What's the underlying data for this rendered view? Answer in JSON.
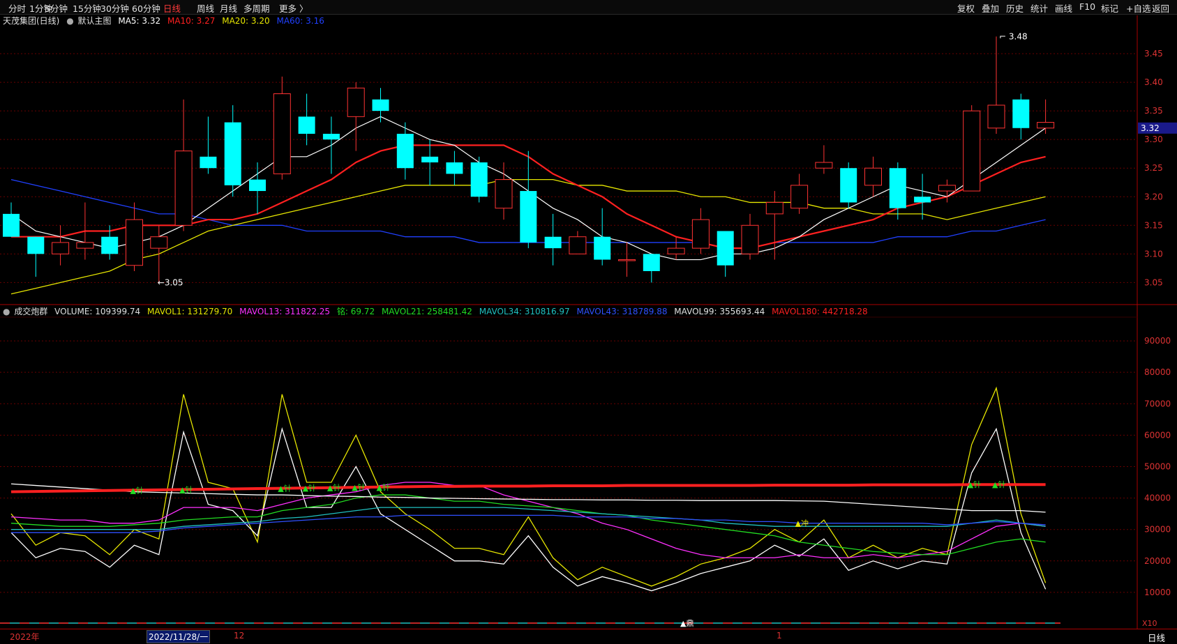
{
  "toolbar": {
    "left": [
      "分时",
      "1分钟",
      "5分钟",
      "15分钟",
      "30分钟",
      "60分钟",
      "日线",
      "周线",
      "月线",
      "多周期",
      "更多 〉"
    ],
    "active": "日线",
    "right": [
      "复权",
      "叠加",
      "历史",
      "统计",
      "画线",
      "F10",
      "标记",
      "+自选",
      "返回"
    ]
  },
  "main_header": {
    "stock": "天茂集团(日线)",
    "main_label": "默认主图",
    "ma5": "MA5: 3.32",
    "ma10": "MA10: 3.27",
    "ma20": "MA20: 3.20",
    "ma60": "MA60: 3.16"
  },
  "vol_header": {
    "name": "成交炮群",
    "volume": "VOLUME: 109399.74",
    "mavol1": "MAVOL1: 131279.70",
    "mavol13": "MAVOL13: 311822.25",
    "ming": "铭: 69.72",
    "mavol21": "MAVOL21: 258481.42",
    "mavol34": "MAVOL34: 310816.97",
    "mavol43": "MAVOL43: 318789.88",
    "mavol99": "MAVOL99: 355693.44",
    "mavol180": "MAVOL180: 442718.28"
  },
  "annotations": {
    "high": "3.48",
    "low": "3.05",
    "current_price": "3.32",
    "x10": "X10",
    "ding": "▲鼎",
    "chong": "▲冲",
    "zhen": "▲针"
  },
  "bottom_axis": {
    "year": "2022年",
    "cursor_date": "2022/11/28/一",
    "month12": "12",
    "month1": "1",
    "period": "日线"
  },
  "colors": {
    "up": "#ff3333",
    "down": "#00ffff",
    "ma5": "#ffffff",
    "ma10": "#ff2020",
    "ma20": "#e6e600",
    "ma60": "#2040ff"
  },
  "chart_data": [
    {
      "type": "candlestick",
      "y_ticks": [
        3.05,
        3.1,
        3.15,
        3.2,
        3.25,
        3.3,
        3.35,
        3.4,
        3.45
      ],
      "ylim": [
        3.02,
        3.5
      ],
      "candles": [
        {
          "o": 3.17,
          "c": 3.13,
          "h": 3.19,
          "l": 3.13
        },
        {
          "o": 3.13,
          "c": 3.1,
          "h": 3.13,
          "l": 3.06
        },
        {
          "o": 3.1,
          "c": 3.12,
          "h": 3.15,
          "l": 3.08
        },
        {
          "o": 3.11,
          "c": 3.12,
          "h": 3.19,
          "l": 3.09
        },
        {
          "o": 3.13,
          "c": 3.1,
          "h": 3.15,
          "l": 3.09
        },
        {
          "o": 3.08,
          "c": 3.16,
          "h": 3.19,
          "l": 3.07
        },
        {
          "o": 3.11,
          "c": 3.13,
          "h": 3.15,
          "l": 3.05
        },
        {
          "o": 3.15,
          "c": 3.28,
          "h": 3.37,
          "l": 3.14
        },
        {
          "o": 3.27,
          "c": 3.25,
          "h": 3.34,
          "l": 3.24
        },
        {
          "o": 3.33,
          "c": 3.22,
          "h": 3.36,
          "l": 3.2
        },
        {
          "o": 3.23,
          "c": 3.21,
          "h": 3.26,
          "l": 3.17
        },
        {
          "o": 3.24,
          "c": 3.38,
          "h": 3.41,
          "l": 3.23
        },
        {
          "o": 3.34,
          "c": 3.31,
          "h": 3.38,
          "l": 3.29
        },
        {
          "o": 3.31,
          "c": 3.3,
          "h": 3.34,
          "l": 3.24
        },
        {
          "o": 3.34,
          "c": 3.39,
          "h": 3.4,
          "l": 3.28
        },
        {
          "o": 3.37,
          "c": 3.35,
          "h": 3.39,
          "l": 3.33
        },
        {
          "o": 3.31,
          "c": 3.25,
          "h": 3.33,
          "l": 3.23
        },
        {
          "o": 3.27,
          "c": 3.26,
          "h": 3.3,
          "l": 3.22
        },
        {
          "o": 3.26,
          "c": 3.24,
          "h": 3.28,
          "l": 3.22
        },
        {
          "o": 3.26,
          "c": 3.2,
          "h": 3.27,
          "l": 3.19
        },
        {
          "o": 3.18,
          "c": 3.23,
          "h": 3.26,
          "l": 3.16
        },
        {
          "o": 3.21,
          "c": 3.12,
          "h": 3.28,
          "l": 3.11
        },
        {
          "o": 3.13,
          "c": 3.11,
          "h": 3.17,
          "l": 3.08
        },
        {
          "o": 3.1,
          "c": 3.13,
          "h": 3.14,
          "l": 3.1
        },
        {
          "o": 3.13,
          "c": 3.09,
          "h": 3.18,
          "l": 3.08
        },
        {
          "o": 3.09,
          "c": 3.09,
          "h": 3.12,
          "l": 3.06
        },
        {
          "o": 3.1,
          "c": 3.07,
          "h": 3.1,
          "l": 3.05
        },
        {
          "o": 3.1,
          "c": 3.11,
          "h": 3.13,
          "l": 3.09
        },
        {
          "o": 3.11,
          "c": 3.16,
          "h": 3.18,
          "l": 3.1
        },
        {
          "o": 3.14,
          "c": 3.08,
          "h": 3.14,
          "l": 3.06
        },
        {
          "o": 3.1,
          "c": 3.15,
          "h": 3.17,
          "l": 3.09
        },
        {
          "o": 3.17,
          "c": 3.19,
          "h": 3.21,
          "l": 3.09
        },
        {
          "o": 3.18,
          "c": 3.22,
          "h": 3.24,
          "l": 3.17
        },
        {
          "o": 3.25,
          "c": 3.26,
          "h": 3.29,
          "l": 3.24
        },
        {
          "o": 3.25,
          "c": 3.19,
          "h": 3.26,
          "l": 3.18
        },
        {
          "o": 3.22,
          "c": 3.25,
          "h": 3.27,
          "l": 3.2
        },
        {
          "o": 3.25,
          "c": 3.18,
          "h": 3.26,
          "l": 3.16
        },
        {
          "o": 3.2,
          "c": 3.19,
          "h": 3.24,
          "l": 3.16
        },
        {
          "o": 3.21,
          "c": 3.22,
          "h": 3.23,
          "l": 3.19
        },
        {
          "o": 3.21,
          "c": 3.35,
          "h": 3.36,
          "l": 3.21
        },
        {
          "o": 3.32,
          "c": 3.36,
          "h": 3.48,
          "l": 3.31
        },
        {
          "o": 3.37,
          "c": 3.32,
          "h": 3.38,
          "l": 3.3
        },
        {
          "o": 3.32,
          "c": 3.33,
          "h": 3.37,
          "l": 3.31
        }
      ],
      "ma5": [
        3.17,
        3.14,
        3.13,
        3.12,
        3.11,
        3.12,
        3.13,
        3.15,
        3.18,
        3.21,
        3.24,
        3.27,
        3.27,
        3.29,
        3.32,
        3.34,
        3.32,
        3.3,
        3.29,
        3.26,
        3.24,
        3.21,
        3.18,
        3.16,
        3.13,
        3.12,
        3.1,
        3.09,
        3.09,
        3.1,
        3.1,
        3.11,
        3.13,
        3.16,
        3.18,
        3.2,
        3.22,
        3.21,
        3.2,
        3.23,
        3.26,
        3.29,
        3.32
      ],
      "ma10": [
        3.13,
        3.13,
        3.13,
        3.14,
        3.14,
        3.15,
        3.15,
        3.15,
        3.16,
        3.16,
        3.17,
        3.19,
        3.21,
        3.23,
        3.26,
        3.28,
        3.29,
        3.29,
        3.29,
        3.29,
        3.29,
        3.27,
        3.24,
        3.22,
        3.2,
        3.17,
        3.15,
        3.13,
        3.12,
        3.11,
        3.11,
        3.12,
        3.13,
        3.14,
        3.15,
        3.16,
        3.18,
        3.19,
        3.2,
        3.22,
        3.24,
        3.26,
        3.27
      ],
      "ma20": [
        3.03,
        3.04,
        3.05,
        3.06,
        3.07,
        3.09,
        3.1,
        3.12,
        3.14,
        3.15,
        3.16,
        3.17,
        3.18,
        3.19,
        3.2,
        3.21,
        3.22,
        3.22,
        3.22,
        3.22,
        3.23,
        3.23,
        3.23,
        3.22,
        3.22,
        3.21,
        3.21,
        3.21,
        3.2,
        3.2,
        3.19,
        3.19,
        3.19,
        3.18,
        3.18,
        3.17,
        3.17,
        3.17,
        3.16,
        3.17,
        3.18,
        3.19,
        3.2
      ],
      "ma60": [
        3.23,
        3.22,
        3.21,
        3.2,
        3.19,
        3.18,
        3.17,
        3.17,
        3.16,
        3.15,
        3.15,
        3.15,
        3.14,
        3.14,
        3.14,
        3.14,
        3.13,
        3.13,
        3.13,
        3.12,
        3.12,
        3.12,
        3.12,
        3.12,
        3.12,
        3.12,
        3.12,
        3.12,
        3.12,
        3.11,
        3.11,
        3.12,
        3.12,
        3.12,
        3.12,
        3.12,
        3.13,
        3.13,
        3.13,
        3.14,
        3.14,
        3.15,
        3.16
      ]
    },
    {
      "type": "line",
      "y_ticks": [
        10000,
        20000,
        30000,
        40000,
        50000,
        60000,
        70000,
        80000,
        90000
      ],
      "ylim": [
        0,
        96000
      ],
      "series": [
        {
          "name": "VOLUME",
          "color": "#e6e600",
          "values": [
            35000,
            25000,
            29000,
            28000,
            22000,
            30000,
            27000,
            73000,
            45000,
            43000,
            26000,
            73000,
            45000,
            45000,
            60000,
            42000,
            35000,
            30000,
            24000,
            24000,
            22000,
            34000,
            21000,
            14000,
            18000,
            15000,
            12000,
            15000,
            19000,
            21000,
            24000,
            30000,
            26000,
            33000,
            21000,
            25000,
            21000,
            24000,
            22000,
            57000,
            75000,
            35000,
            13000
          ]
        },
        {
          "name": "MAVOL1",
          "color": "#ffffff",
          "values": [
            29000,
            21000,
            24000,
            23000,
            18000,
            25000,
            22000,
            61000,
            38000,
            36000,
            28000,
            62000,
            37000,
            37000,
            50000,
            35000,
            30000,
            25000,
            20000,
            20000,
            19000,
            28000,
            18000,
            12000,
            15000,
            13000,
            10500,
            13000,
            16000,
            18000,
            20000,
            25000,
            21500,
            27000,
            17000,
            20000,
            17500,
            20000,
            19000,
            48000,
            62000,
            29000,
            11000
          ]
        },
        {
          "name": "MAVOL13",
          "color": "#ff30ff",
          "values": [
            34000,
            33500,
            33000,
            33000,
            32000,
            32000,
            33000,
            37000,
            37000,
            37000,
            36000,
            38000,
            40000,
            41000,
            42000,
            44000,
            45000,
            45000,
            44000,
            44000,
            41000,
            39000,
            37000,
            35000,
            32000,
            30000,
            27000,
            24000,
            22000,
            21000,
            21000,
            21000,
            22000,
            21000,
            21000,
            22000,
            21000,
            22000,
            23000,
            27000,
            31000,
            32000,
            31000
          ]
        },
        {
          "name": "MAVOL21",
          "color": "#22dd22",
          "values": [
            32000,
            31500,
            31000,
            31000,
            31000,
            31500,
            32000,
            33000,
            33500,
            34000,
            34000,
            36000,
            37000,
            38000,
            40000,
            41000,
            41000,
            40000,
            39000,
            39000,
            38000,
            37500,
            37000,
            36000,
            35000,
            34500,
            33000,
            32000,
            31000,
            30000,
            29000,
            28000,
            26000,
            25000,
            24000,
            23000,
            22500,
            22000,
            22000,
            24000,
            26000,
            27000,
            26000
          ]
        },
        {
          "name": "MAVOL34",
          "color": "#20c0c0",
          "values": [
            30000,
            30000,
            30000,
            30000,
            30000,
            30000,
            30000,
            31000,
            31500,
            32000,
            32500,
            33500,
            34000,
            35000,
            36000,
            37000,
            37000,
            37000,
            37000,
            37000,
            37000,
            36500,
            36000,
            35500,
            35000,
            34500,
            34000,
            33500,
            33000,
            32000,
            31500,
            31000,
            31000,
            31000,
            31000,
            31000,
            31000,
            31000,
            31000,
            32000,
            33000,
            32000,
            31000
          ]
        },
        {
          "name": "MAVOL43",
          "color": "#3050ff",
          "values": [
            29000,
            29000,
            29000,
            29000,
            29000,
            29000,
            29500,
            30500,
            31000,
            31500,
            32000,
            32500,
            33000,
            33500,
            34000,
            34000,
            34500,
            34500,
            34500,
            34500,
            34500,
            34500,
            34500,
            34000,
            34000,
            34000,
            33500,
            33500,
            33000,
            33000,
            32500,
            32500,
            32000,
            32000,
            32000,
            32000,
            32000,
            32000,
            31500,
            32000,
            32500,
            32000,
            31500
          ]
        },
        {
          "name": "MAVOL99",
          "color": "#ffffff",
          "values": [
            44500,
            44000,
            43500,
            43000,
            42500,
            42000,
            41800,
            41600,
            41400,
            41200,
            41000,
            41000,
            40800,
            40600,
            40500,
            40300,
            40200,
            40000,
            39900,
            39800,
            39700,
            39600,
            39500,
            39500,
            39400,
            39400,
            39300,
            39300,
            39200,
            39200,
            39200,
            39200,
            39100,
            39000,
            38500,
            38000,
            37500,
            37000,
            36500,
            36000,
            36000,
            36000,
            35500
          ]
        },
        {
          "name": "MAVOL180",
          "color": "#ff2020",
          "values": [
            42000,
            42100,
            42200,
            42300,
            42400,
            42500,
            42600,
            42700,
            42800,
            42900,
            43000,
            43100,
            43200,
            43300,
            43400,
            43500,
            43600,
            43700,
            43700,
            43800,
            43800,
            43800,
            43900,
            43900,
            43900,
            44000,
            44000,
            44000,
            44000,
            44000,
            44000,
            44100,
            44100,
            44100,
            44100,
            44200,
            44200,
            44200,
            44200,
            44300,
            44300,
            44300,
            44300
          ]
        }
      ]
    }
  ]
}
